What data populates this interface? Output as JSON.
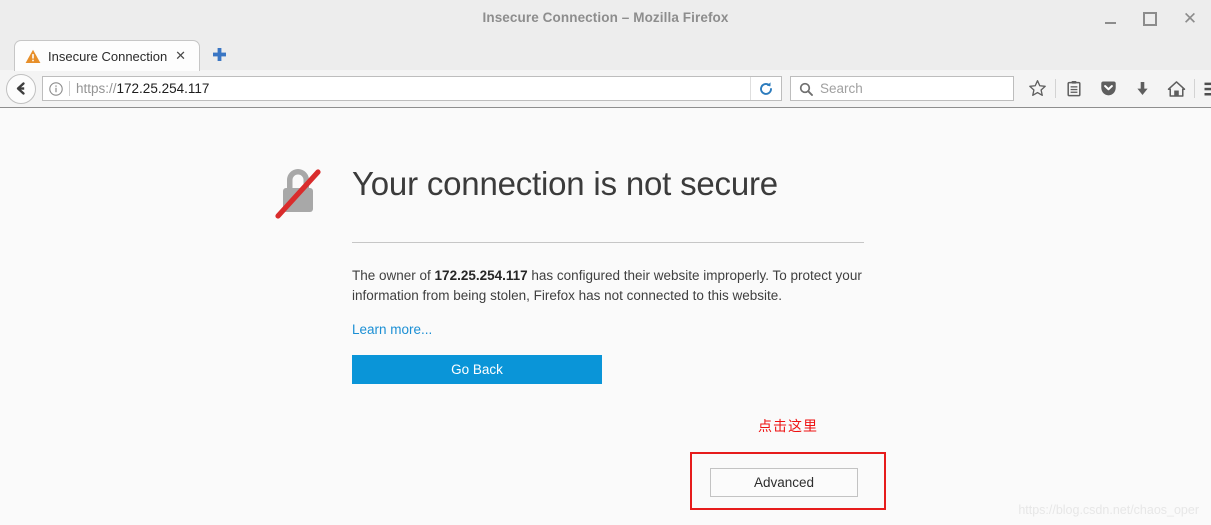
{
  "window": {
    "title": "Insecure Connection – Mozilla Firefox",
    "controls": {
      "minimize": "–",
      "maximize": "□",
      "close": "✕"
    }
  },
  "tabs": [
    {
      "label": "Insecure Connection",
      "close_label": "✕",
      "icon": "warning-triangle-icon"
    }
  ],
  "newtab": {
    "label": "+"
  },
  "toolbar": {
    "back_icon": "back-arrow-icon",
    "identity_icon": "info-icon",
    "url_scheme": "https://",
    "url_host": "172.25.254.117",
    "reload_icon": "reload-icon",
    "search_placeholder": "Search",
    "search_value": "",
    "icons": [
      "bookmark-star-icon",
      "reader-list-icon",
      "pocket-icon",
      "downloads-icon",
      "home-icon",
      "menu-hamburger-icon"
    ]
  },
  "error_page": {
    "icon": "broken-lock-icon",
    "title": "Your connection is not secure",
    "body_part1": "The owner of ",
    "body_host": "172.25.254.117",
    "body_part2": " has configured their website improperly. To protect your information from being stolen, Firefox has not connected to this website.",
    "learn_more": "Learn more...",
    "go_back_label": "Go Back",
    "advanced_label": "Advanced"
  },
  "annotation": {
    "text": "点击这里",
    "color": "#ee1111"
  },
  "watermark": {
    "text": "https://blog.csdn.net/chaos_oper"
  },
  "colors": {
    "primary_button": "#0a95d8",
    "link": "#1b8fd4",
    "annotation": "#e61c1c",
    "warning": "#e78f2a"
  }
}
